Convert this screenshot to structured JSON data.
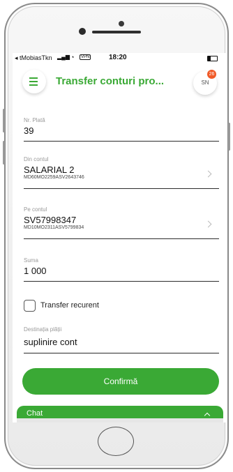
{
  "status_bar": {
    "carrier": "◂ tMobiasTkn",
    "signal": "▂▄▆",
    "wifi": "◔",
    "vpn": "VPN",
    "time": "18:20"
  },
  "header": {
    "title": "Transfer conturi pro...",
    "avatar_initials": "SN",
    "notification_count": "26"
  },
  "form": {
    "payment_number": {
      "label": "Nr. Plată",
      "value": "39"
    },
    "from_account": {
      "label": "Din contul",
      "name": "SALARIAL 2",
      "iban": "MD60MO2259ASV2643746"
    },
    "to_account": {
      "label": "Pe contul",
      "name": "SV57998347",
      "iban": "MD10MO2311ASV5799834"
    },
    "amount": {
      "label": "Suma",
      "value": "1 000"
    },
    "recurrent": {
      "label": "Transfer recurent",
      "checked": false
    },
    "destination": {
      "label": "Destinația plății",
      "value": "suplinire cont"
    }
  },
  "confirm_label": "Confirmă",
  "chat": {
    "label": "Chat"
  },
  "colors": {
    "accent": "#3aa935",
    "badge": "#f05a28"
  }
}
